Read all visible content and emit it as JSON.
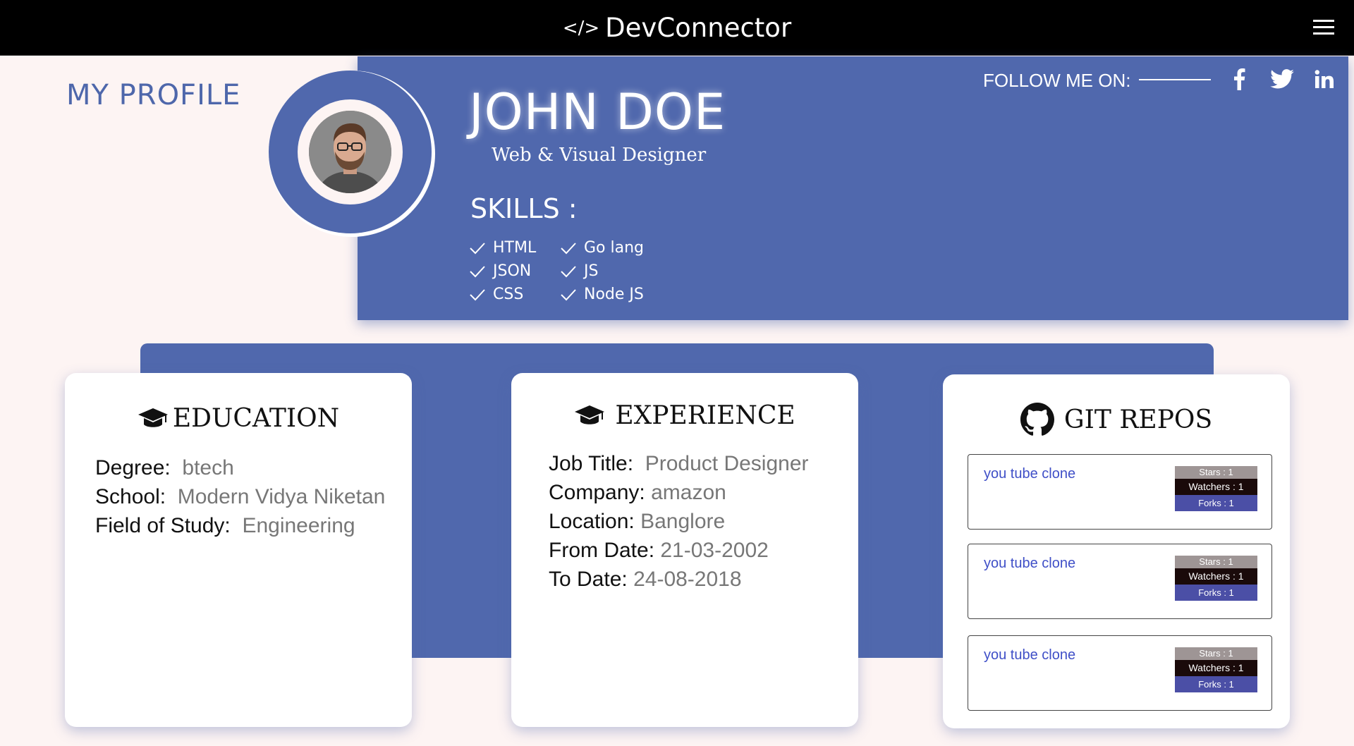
{
  "navbar": {
    "brand_icon": "</>",
    "brand": "DevConnector",
    "menu_icon": "hamburger-menu-icon"
  },
  "page": {
    "title": "MY PROFILE"
  },
  "profile": {
    "name": "JOHN DOE",
    "role": "Web & Visual Designer",
    "skills_title": "SKILLS :",
    "skills": [
      "HTML",
      "JSON",
      "CSS",
      "Go lang",
      "JS",
      "Node JS"
    ],
    "follow_label": "FOLLOW ME ON:",
    "social": [
      "facebook-icon",
      "twitter-icon",
      "linkedin-icon"
    ]
  },
  "education": {
    "title": "EDUCATION",
    "rows": [
      {
        "label": "Degree:",
        "value": "btech"
      },
      {
        "label": "School:",
        "value": "Modern Vidya Niketan"
      },
      {
        "label": "Field of Study:",
        "value": "Engineering"
      }
    ]
  },
  "experience": {
    "title": "EXPERIENCE",
    "rows": [
      {
        "label": "Job Title:",
        "value": "Product Designer"
      },
      {
        "label": "Company:",
        "value": "amazon"
      },
      {
        "label": "Location:",
        "value": "Banglore"
      },
      {
        "label": "From Date:",
        "value": "21-03-2002"
      },
      {
        "label": "To Date:",
        "value": "24-08-2018"
      }
    ]
  },
  "repos": {
    "title": "GIT REPOS",
    "items": [
      {
        "name": "you tube clone",
        "stars": "Stars : 1",
        "watchers": "Watchers : 1",
        "forks": "Forks : 1"
      },
      {
        "name": "you tube clone",
        "stars": "Stars : 1",
        "watchers": "Watchers : 1",
        "forks": "Forks : 1"
      },
      {
        "name": "you tube clone",
        "stars": "Stars : 1",
        "watchers": "Watchers : 1",
        "forks": "Forks : 1"
      }
    ]
  },
  "colors": {
    "primary": "#5068ad",
    "page_bg": "#fdf4f3",
    "navbar_bg": "#000000",
    "link": "#3f4fc7",
    "stars_bg": "#9e9595",
    "watchers_bg": "#1a0a0a",
    "forks_bg": "#4b4fa6"
  }
}
